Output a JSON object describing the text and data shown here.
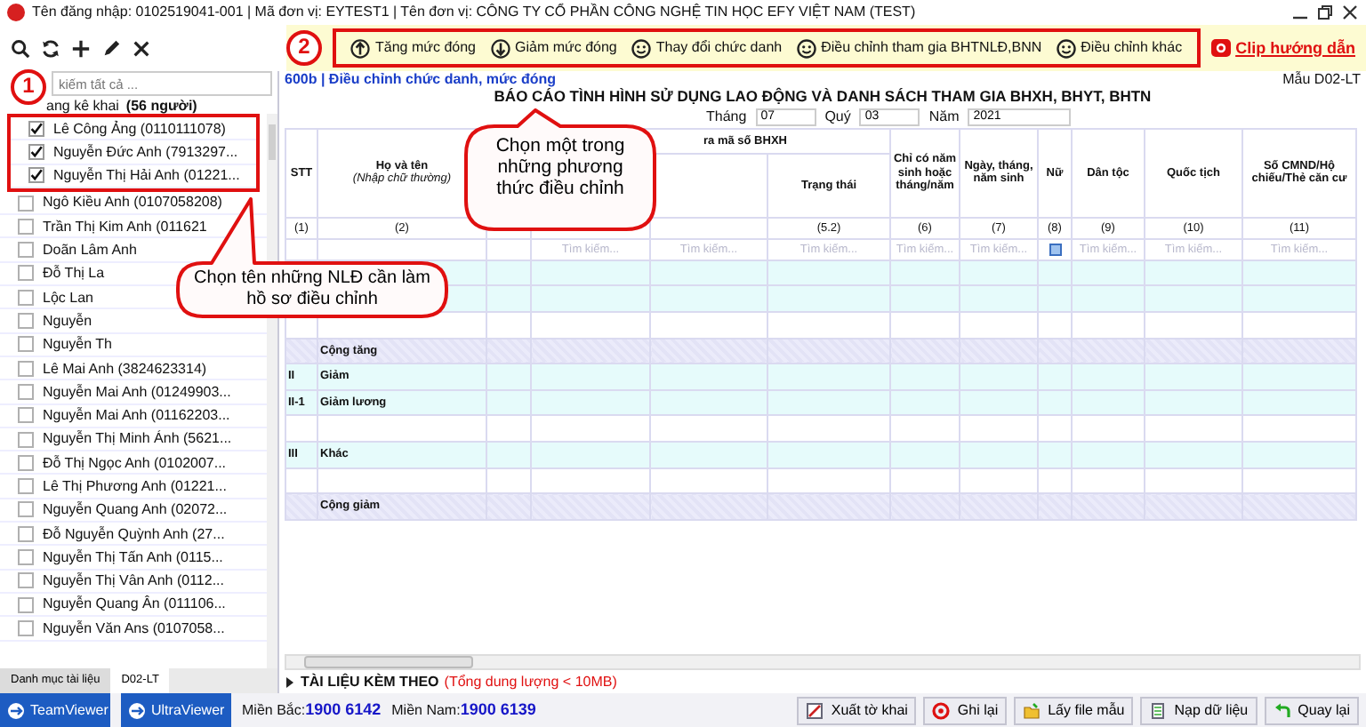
{
  "title_bar": {
    "text": "Tên đăng nhập: 0102519041-001 | Mã đơn vị: EYTEST1 | Tên đơn vị: CÔNG TY CỔ PHẦN CÔNG NGHỆ TIN HỌC EFY VIỆT NAM (TEST)"
  },
  "adjustments": {
    "step": "2",
    "buttons": [
      {
        "label": "Tăng mức đóng",
        "kind": "increase"
      },
      {
        "label": "Giảm mức đóng",
        "kind": "decrease"
      },
      {
        "label": "Thay đổi chức danh",
        "kind": "adjust"
      },
      {
        "label": "Điều chỉnh tham gia BHTNLĐ,BNN",
        "kind": "adjust"
      },
      {
        "label": "Điều chỉnh khác",
        "kind": "adjust"
      }
    ]
  },
  "help_link": {
    "label": "Clip hướng dẫn"
  },
  "employee_list": {
    "step": "1",
    "search_placeholder": "kiếm tất cả ...",
    "header": "ang kê khai",
    "count": "(56 người)",
    "items": [
      {
        "label": "Lê Công Ảng (0110111078)",
        "checked": true
      },
      {
        "label": "Nguyễn Đức Anh (7913297...",
        "checked": true
      },
      {
        "label": "Nguyễn Thị Hải Anh (01221...",
        "checked": true
      },
      {
        "label": "Ngô Kiều Anh (0107058208)",
        "checked": false
      },
      {
        "label": "Trần Thị Kim Anh (011621",
        "checked": false
      },
      {
        "label": "Doãn Lâm Anh",
        "checked": false
      },
      {
        "label": "Đỗ Thị La",
        "checked": false
      },
      {
        "label": "Lộc Lan",
        "checked": false
      },
      {
        "label": "Nguyễn",
        "checked": false
      },
      {
        "label": "Nguyễn Th",
        "checked": false
      },
      {
        "label": "Lê Mai Anh (3824623314)",
        "checked": false
      },
      {
        "label": "Nguyễn Mai Anh (01249903...",
        "checked": false
      },
      {
        "label": "Nguyễn Mai Anh (01162203...",
        "checked": false
      },
      {
        "label": "Nguyễn Thị Minh Ánh (5621...",
        "checked": false
      },
      {
        "label": "Đỗ Thị Ngọc Anh (0102007...",
        "checked": false
      },
      {
        "label": "Lê Thị Phương Anh (01221...",
        "checked": false
      },
      {
        "label": "Nguyễn Quang Anh (02072...",
        "checked": false
      },
      {
        "label": "Đỗ Nguyễn Quỳnh Anh (27...",
        "checked": false
      },
      {
        "label": "Nguyễn Thị Tấn Anh (0115...",
        "checked": false
      },
      {
        "label": "Nguyễn Thị Vân Anh (0112...",
        "checked": false
      },
      {
        "label": "Nguyễn Quang Ân (011106...",
        "checked": false
      },
      {
        "label": "Nguyễn Văn Ans (0107058...",
        "checked": false
      }
    ]
  },
  "bottom_tabs": [
    {
      "label": "Danh mục tài liệu",
      "selected": false
    },
    {
      "label": "D02-LT",
      "selected": true
    }
  ],
  "form": {
    "subtitle": "600b | Điều chỉnh chức danh, mức đóng",
    "form_code": "Mẫu D02-LT",
    "title": "BÁO CÁO TÌNH HÌNH SỬ DỤNG LAO ĐỘNG VÀ DANH SÁCH THAM GIA BHXH, BHYT, BHTN",
    "period": [
      {
        "label": "Tháng",
        "value": "07"
      },
      {
        "label": "Quý",
        "value": "03"
      },
      {
        "label": "Năm",
        "value": "2021"
      }
    ],
    "group_header": "ra mã số BHXH",
    "columns": [
      {
        "label": "STT",
        "number": "(1)"
      },
      {
        "label": "Họ và tên",
        "hint": "(Nhập chữ thường)",
        "number": "(2)"
      },
      {},
      {
        "in_group": true,
        "placeholder": "Tìm kiếm..."
      },
      {
        "in_group": true,
        "placeholder": "Tìm kiếm..."
      },
      {
        "label": "Trạng thái",
        "number": "(5.2)",
        "in_group": true,
        "placeholder": "Tìm kiếm..."
      },
      {
        "label": "Chỉ có năm sinh hoặc tháng/năm",
        "number": "(6)",
        "placeholder": "Tìm kiếm..."
      },
      {
        "label": "Ngày, tháng, năm sinh",
        "number": "(7)",
        "placeholder": "Tìm kiếm..."
      },
      {
        "label": "Nữ",
        "number": "(8)",
        "kind": "checkbox"
      },
      {
        "label": "Dân tộc",
        "number": "(9)",
        "placeholder": "Tìm kiếm..."
      },
      {
        "label": "Quốc tịch",
        "number": "(10)",
        "placeholder": "Tìm kiếm..."
      },
      {
        "label": "Số CMND/Hộ chiếu/Thẻ căn cư",
        "number": "(11)",
        "placeholder": "Tìm kiếm..."
      }
    ],
    "rows": [
      {
        "kind": "entry"
      },
      {
        "kind": "entry"
      },
      {
        "kind": "blank"
      },
      {
        "kind": "total",
        "label": "Cộng tăng"
      },
      {
        "kind": "section",
        "code": "II",
        "label": "Giảm"
      },
      {
        "kind": "section",
        "code": "II-1",
        "label": "Giảm lương"
      },
      {
        "kind": "blank"
      },
      {
        "kind": "section",
        "code": "III",
        "label": "Khác"
      },
      {
        "kind": "blank"
      },
      {
        "kind": "total",
        "label": "Cộng giảm"
      }
    ]
  },
  "attachments": {
    "title": "TÀI LIỆU KÈM THEO",
    "note": "(Tổng dung lượng < 10MB)",
    "expanded": false
  },
  "taskbar": [
    {
      "label": "TeamViewer"
    },
    {
      "label": "UltraViewer"
    }
  ],
  "hotlines": [
    {
      "region": "Miền Bắc:",
      "phone": "1900 6142"
    },
    {
      "region": "Miền Nam:",
      "phone": "1900 6139"
    }
  ],
  "actions": [
    {
      "label": "Xuất tờ khai",
      "kind": "export"
    },
    {
      "label": "Ghi lại",
      "kind": "save"
    },
    {
      "label": "Lấy file mẫu",
      "kind": "template"
    },
    {
      "label": "Nạp dữ liệu",
      "kind": "load"
    },
    {
      "label": "Quay lại",
      "kind": "back"
    }
  ],
  "callouts": [
    {
      "text": "Chọn tên những NLĐ cần làm hồ sơ điều chỉnh"
    },
    {
      "text": "Chọn một trong những phương thức điều chỉnh"
    }
  ]
}
